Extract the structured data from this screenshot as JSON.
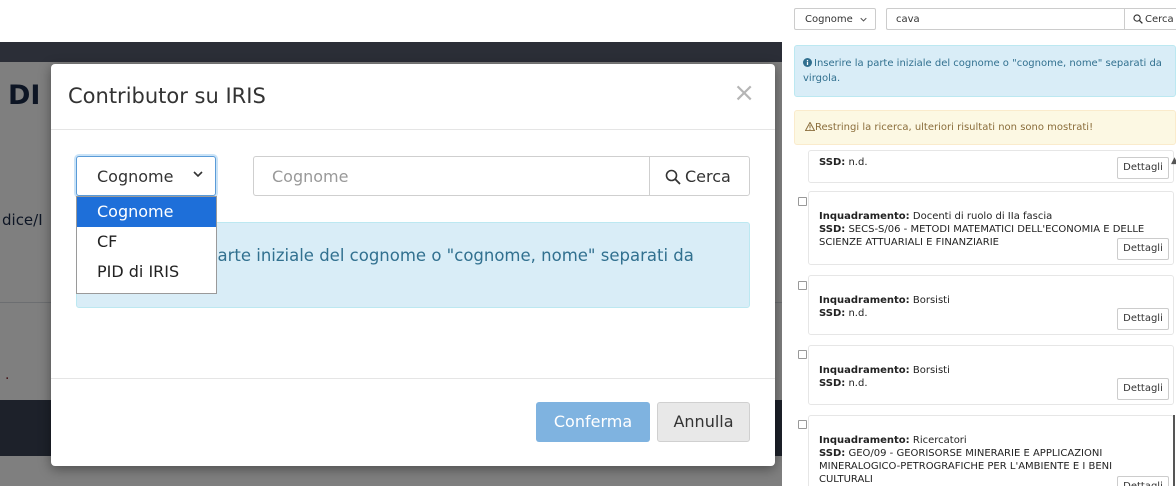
{
  "modal_view": {
    "background": {
      "heading": "DI",
      "path_fragment": "dice/I",
      "dot": "."
    },
    "modal": {
      "title": "Contributor su IRIS",
      "close_glyph": "×",
      "search_field_select": {
        "selected": "Cognome",
        "options": [
          "Cognome",
          "CF",
          "PID di IRIS"
        ]
      },
      "search_input": {
        "value": "",
        "placeholder": "Cognome"
      },
      "search_button_label": "Cerca",
      "info_text": "parte iniziale del cognome o \"cognome, nome\" separati da",
      "confirm_label": "Conferma",
      "cancel_label": "Annulla"
    }
  },
  "results_view": {
    "search_field_select": "Cognome",
    "search_input_value": "cava",
    "search_button_label": "Cerca",
    "info_text": "Inserire la parte iniziale del cognome o \"cognome, nome\" separati da virgola.",
    "warning_text": "Restringi la ricerca, ulteriori risultati non sono mostrati!",
    "results": [
      {
        "inquadramento": "",
        "ssd": "n.d.",
        "details_label": "Dettagli"
      },
      {
        "inquadramento": "Docenti di ruolo di IIa fascia",
        "ssd": "SECS-S/06 - METODI MATEMATICI DELL'ECONOMIA E DELLE SCIENZE ATTUARIALI E FINANZIARIE",
        "details_label": "Dettagli"
      },
      {
        "inquadramento": "Borsisti",
        "ssd": "n.d.",
        "details_label": "Dettagli"
      },
      {
        "inquadramento": "Borsisti",
        "ssd": "n.d.",
        "details_label": "Dettagli"
      },
      {
        "inquadramento": "Ricercatori",
        "ssd": "GEO/09 - GEORISORSE MINERARIE E APPLICAZIONI MINERALOGICO-PETROGRAFICHE PER L'AMBIENTE E I BENI CULTURALI",
        "details_label": "Dettagli"
      }
    ],
    "labels": {
      "inquadramento": "Inquadramento:",
      "ssd": "SSD:"
    }
  },
  "colors": {
    "primary": "#337ab7",
    "primary_disabled": "#7fb3e0",
    "info_bg": "#d9edf7",
    "info_text": "#31708f",
    "warning_bg": "#fcf8e3",
    "warning_text": "#8a6d3b",
    "select_highlight": "#1e6fd9"
  }
}
